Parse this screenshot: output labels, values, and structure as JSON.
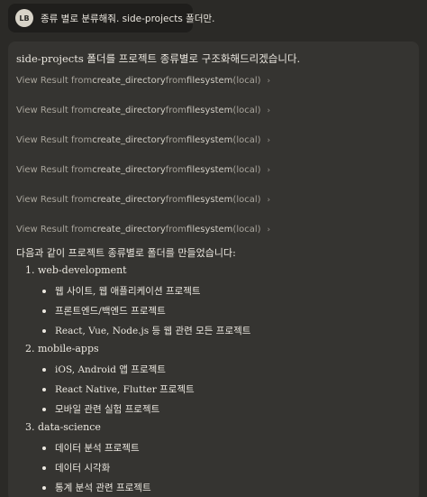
{
  "user": {
    "avatar_initials": "LB",
    "message": "종류 별로 분류해줘. side-projects 폴더만."
  },
  "assistant": {
    "intro": "side-projects 폴더를 프로젝트 종류별로 구조화해드리겠습니다.",
    "tool_calls": [
      {
        "prefix": "View Result from ",
        "tool": "create_directory",
        "mid": " from ",
        "server": "filesystem",
        "suffix": " (local)"
      },
      {
        "prefix": "View Result from ",
        "tool": "create_directory",
        "mid": " from ",
        "server": "filesystem",
        "suffix": " (local)"
      },
      {
        "prefix": "View Result from ",
        "tool": "create_directory",
        "mid": " from ",
        "server": "filesystem",
        "suffix": " (local)"
      },
      {
        "prefix": "View Result from ",
        "tool": "create_directory",
        "mid": " from ",
        "server": "filesystem",
        "suffix": " (local)"
      },
      {
        "prefix": "View Result from ",
        "tool": "create_directory",
        "mid": " from ",
        "server": "filesystem",
        "suffix": " (local)"
      },
      {
        "prefix": "View Result from ",
        "tool": "create_directory",
        "mid": " from ",
        "server": "filesystem",
        "suffix": " (local)"
      }
    ],
    "summary": "다음과 같이 프로젝트 종류별로 폴더를 만들었습니다:",
    "categories": [
      {
        "label": "1. web-development",
        "items": [
          "웹 사이트, 웹 애플리케이션 프로젝트",
          "프론트엔드/백엔드 프로젝트",
          "React, Vue, Node.js 등 웹 관련 모든 프로젝트"
        ]
      },
      {
        "label": "2. mobile-apps",
        "items": [
          "iOS, Android 앱 프로젝트",
          "React Native, Flutter 프로젝트",
          "모바일 관련 실험 프로젝트"
        ]
      },
      {
        "label": "3. data-science",
        "items": [
          "데이터 분석 프로젝트",
          "데이터 시각화",
          "통계 분석 관련 프로젝트"
        ]
      }
    ]
  },
  "icons": {
    "tool_expand": "chevron-right-icon",
    "bullet": "bullet-dot-icon"
  }
}
